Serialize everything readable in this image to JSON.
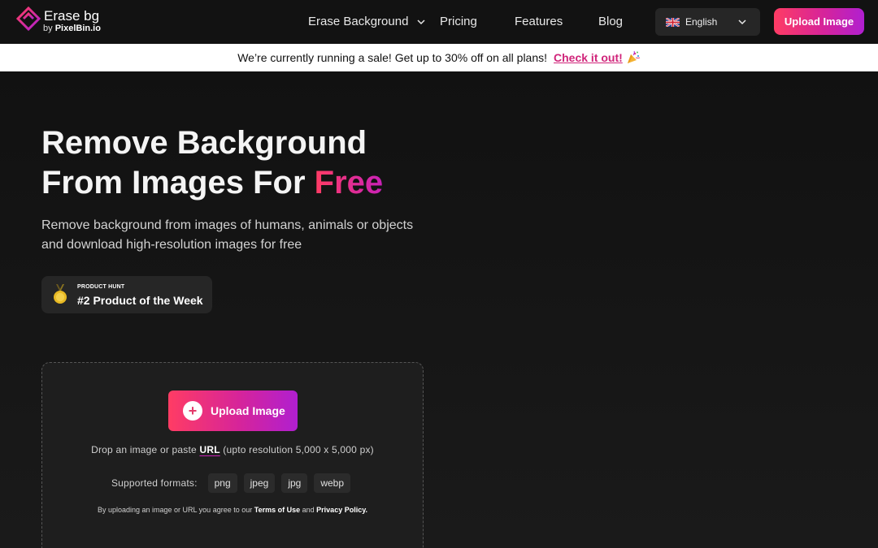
{
  "nav": {
    "brand_title": "Erase bg",
    "brand_sub_prefix": "by",
    "brand_sub_name": "PixelBin.io",
    "links": [
      "Erase Background",
      "Pricing",
      "Features",
      "Blog"
    ],
    "language": "English",
    "upload_label": "Upload Image"
  },
  "banner": {
    "text": "We’re currently running a sale! Get up to 30% off on all plans!",
    "link": "Check it out!"
  },
  "hero": {
    "headline_1": "Remove Background",
    "headline_2": "From Images For",
    "headline_accent": "Free",
    "subtext": "Remove background from images of humans, animals or objects and download high-resolution images for free"
  },
  "badge": {
    "small": "PRODUCT HUNT",
    "big": "#2 Product of the Week"
  },
  "upload": {
    "button": "Upload Image",
    "drop_prefix": "Drop an image or paste",
    "drop_url": "URL",
    "drop_suffix": "(upto resolution 5,000 x 5,000 px)",
    "formats_label": "Supported formats:",
    "formats": [
      "png",
      "jpeg",
      "jpg",
      "webp"
    ],
    "terms_prefix": "By uploading an image or URL you agree to our",
    "terms_link": "Terms of Use",
    "terms_and": "and",
    "privacy_link": "Privacy Policy."
  },
  "colors": {
    "accent_start": "#ff3c64",
    "accent_end": "#b01fd0",
    "background": "#1a1a1a"
  }
}
